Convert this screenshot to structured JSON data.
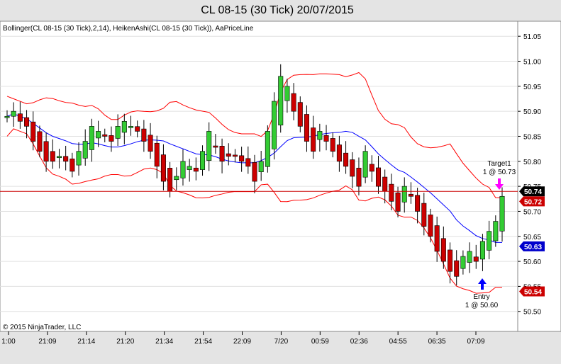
{
  "window": {
    "title": "CL 08-15 (30 Tick)  20/07/2015"
  },
  "indicator_label": "Bollinger(CL 08-15 (30 Tick),2,14), HeikenAshi(CL 08-15 (30 Tick)), AaPriceLine",
  "copyright": "© 2015 NinjaTrader, LLC",
  "colors": {
    "background": "#ffffff",
    "grid": "#e0e0e0",
    "bollinger_band": "#ff0000",
    "bollinger_mid": "#0000ff",
    "bull_candle": "#33cc33",
    "bear_candle": "#cc0000",
    "price_line": "#cc0000",
    "target_arrow": "#ff00ff",
    "entry_arrow": "#0000ff"
  },
  "chart_data": {
    "type": "candlestick",
    "x_tick_labels": [
      "1:00",
      "21:09",
      "21:14",
      "21:20",
      "21:34",
      "21:54",
      "22:09",
      "7/20",
      "00:59",
      "02:36",
      "04:55",
      "06:35",
      "07:09"
    ],
    "y_tick_labels": [
      "51.05",
      "51.00",
      "50.95",
      "50.90",
      "50.85",
      "50.80",
      "50.75",
      "50.70",
      "50.65",
      "50.60",
      "50.55",
      "50.50"
    ],
    "ylim": [
      50.46,
      51.08
    ],
    "price_line": 50.74,
    "badges": [
      {
        "value": "50.74",
        "style": "black"
      },
      {
        "value": "50.72",
        "style": "red"
      },
      {
        "value": "50.63",
        "style": "blue"
      },
      {
        "value": "50.54",
        "style": "red"
      }
    ],
    "annotations": {
      "target_label": "Target1",
      "target_value": "1 @ 50.73",
      "entry_label": "Entry",
      "entry_value": "1 @ 50.60"
    },
    "close_path": [
      50.89,
      50.9,
      50.88,
      50.87,
      50.84,
      50.82,
      50.8,
      50.8,
      50.81,
      50.8,
      50.78,
      50.82,
      50.84,
      50.87,
      50.86,
      50.85,
      50.84,
      50.87,
      50.88,
      50.87,
      50.86,
      50.84,
      50.82,
      50.79,
      50.76,
      50.74,
      50.77,
      50.8,
      50.79,
      50.78,
      50.82,
      50.86,
      50.83,
      50.8,
      50.81,
      50.81,
      50.8,
      50.79,
      50.76,
      50.8,
      50.86,
      50.92,
      50.97,
      50.95,
      50.9,
      50.87,
      50.84,
      50.82,
      50.86,
      50.84,
      50.82,
      50.8,
      50.79,
      50.77,
      50.75,
      50.82,
      50.78,
      50.75,
      50.74,
      50.72,
      50.7,
      50.75,
      50.73,
      50.7,
      50.67,
      50.65,
      50.62,
      50.6,
      50.58,
      50.57,
      50.61,
      50.62,
      50.6,
      50.64,
      50.66,
      50.68,
      50.73
    ]
  }
}
